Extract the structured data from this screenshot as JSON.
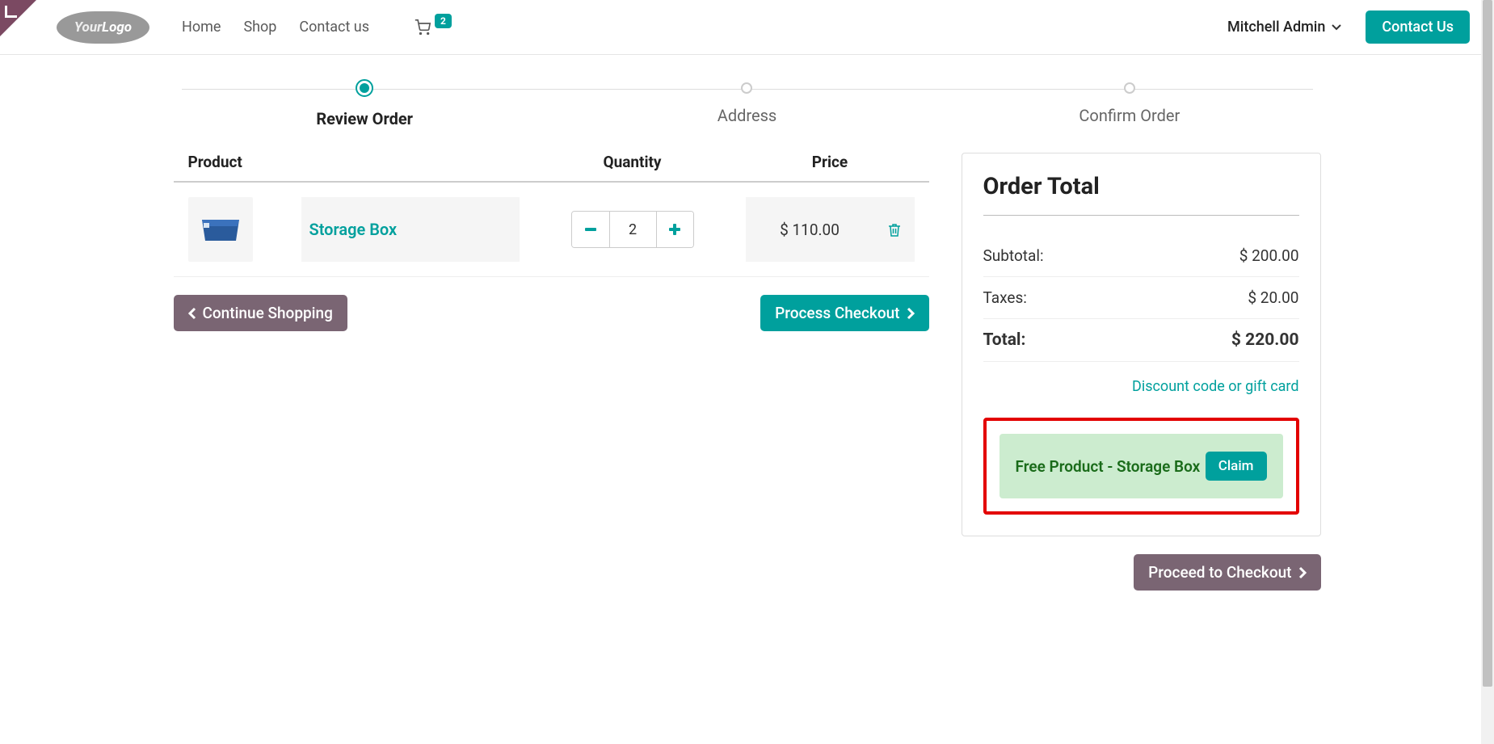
{
  "header": {
    "logo_text_1": "Your",
    "logo_text_2": "Logo",
    "nav": [
      "Home",
      "Shop",
      "Contact us"
    ],
    "cart_count": "2",
    "user": "Mitchell Admin",
    "contact_btn": "Contact Us"
  },
  "steps": [
    {
      "label": "Review Order",
      "active": true
    },
    {
      "label": "Address",
      "active": false
    },
    {
      "label": "Confirm Order",
      "active": false
    }
  ],
  "cart": {
    "headers": {
      "product": "Product",
      "quantity": "Quantity",
      "price": "Price"
    },
    "items": [
      {
        "name": "Storage Box",
        "qty": "2",
        "price": "$ 110.00"
      }
    ],
    "continue_btn": "Continue Shopping",
    "process_btn": "Process Checkout"
  },
  "summary": {
    "title": "Order Total",
    "rows": [
      {
        "label": "Subtotal:",
        "value": "$ 200.00"
      },
      {
        "label": "Taxes:",
        "value": "$ 20.00"
      },
      {
        "label": "Total:",
        "value": "$ 220.00",
        "bold": true
      }
    ],
    "discount_link": "Discount code or gift card",
    "reward": {
      "text": "Free Product - Storage Box",
      "btn": "Claim"
    },
    "proceed_btn": "Proceed to Checkout"
  }
}
